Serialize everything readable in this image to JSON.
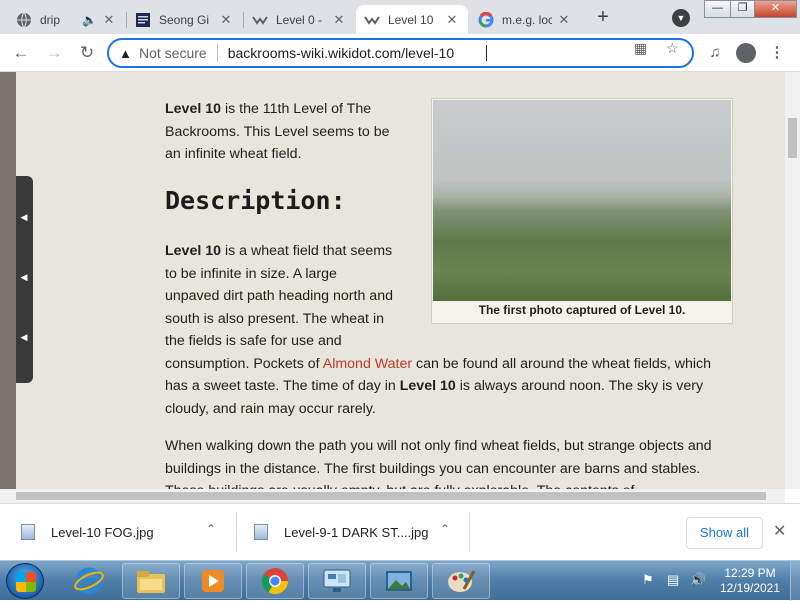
{
  "browser": {
    "tabs": [
      {
        "label": "drip",
        "icon": "globe-icon",
        "audio": true
      },
      {
        "label": "Seong Gi",
        "icon": "book-icon"
      },
      {
        "label": "Level 0 -",
        "icon": "wikidot-icon"
      },
      {
        "label": "Level 10",
        "icon": "wikidot-icon",
        "active": true
      },
      {
        "label": "m.e.g. loc",
        "icon": "google-icon"
      }
    ],
    "new_tab": "+",
    "address": {
      "security_label": "Not secure",
      "url": "backrooms-wiki.wikidot.com/level-10"
    }
  },
  "article": {
    "intro_bold": "Level 10",
    "intro_rest": " is the 11th Level of The Backrooms. This Level seems to be an infinite wheat field.",
    "heading": "Description:",
    "p1_bold1": "Level 10",
    "p1_text1": " is a wheat field that seems to be infinite in size. A large unpaved dirt path heading north and south is also present. The wheat in the fields is safe for use and consumption. Pockets of ",
    "p1_link": "Almond Water",
    "p1_text2": " can be found all around the wheat fields, which has a sweet taste. The time of day in ",
    "p1_bold2": "Level 10",
    "p1_text3": " is always around noon. The sky is very cloudy, and rain may occur rarely.",
    "p2": "When walking down the path you will not only find wheat fields, but strange objects and buildings in the distance. The first buildings you can encounter are barns and stables. These buildings are usually empty, but are fully explorable. The contents of",
    "image_caption": "The first photo captured of Level 10."
  },
  "downloads": {
    "items": [
      {
        "name": "Level-10 FOG.jpg"
      },
      {
        "name": "Level-9-1 DARK ST....jpg"
      }
    ],
    "show_all": "Show all"
  },
  "taskbar": {
    "time": "12:29 PM",
    "date": "12/19/2021"
  },
  "colors": {
    "accent": "#1a73e8",
    "page_bg": "#e7e5dc",
    "link": "#c0392b"
  }
}
